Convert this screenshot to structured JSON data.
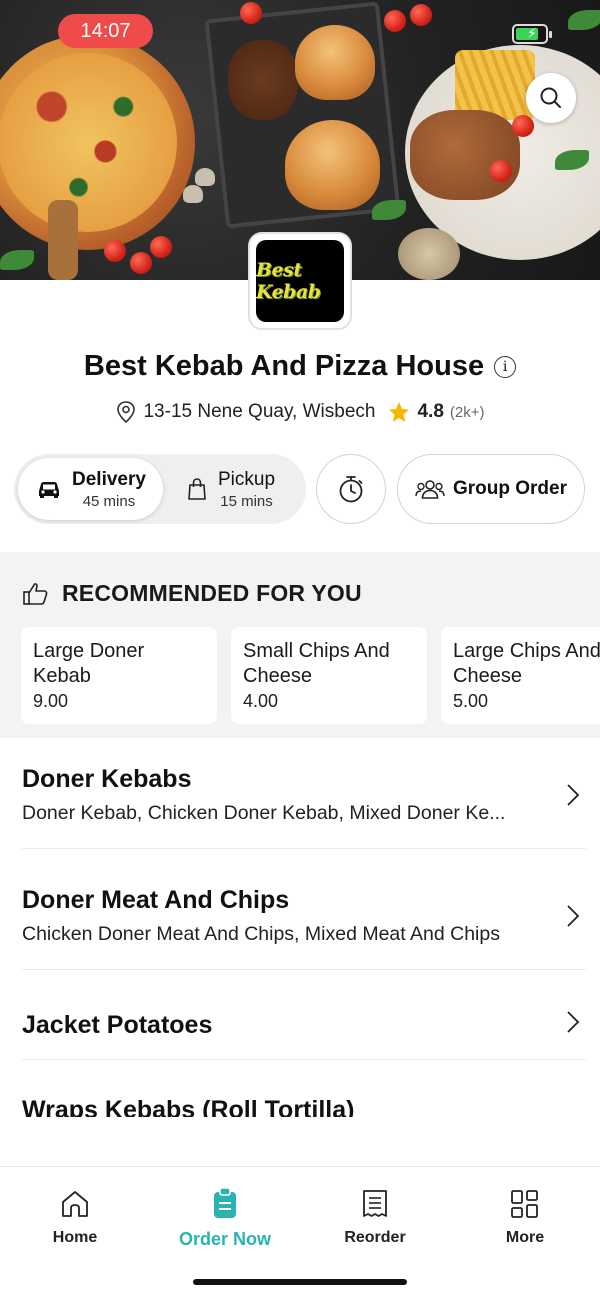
{
  "status": {
    "time": "14:07"
  },
  "icons": {
    "search": "search-icon",
    "info": "info-icon",
    "location": "location-pin-icon",
    "star": "star-icon",
    "car": "car-icon",
    "bag": "shopping-bag-icon",
    "timer": "stopwatch-icon",
    "group": "group-icon",
    "thumbs": "thumbs-up-icon",
    "chevron": "chevron-right-icon"
  },
  "restaurant": {
    "logo_text": "Best Kebab",
    "name": "Best Kebab And Pizza House",
    "address": "13-15 Nene Quay, Wisbech",
    "rating": "4.8",
    "rating_count": "(2k+)"
  },
  "order_type": {
    "delivery_label": "Delivery",
    "delivery_time": "45 mins",
    "pickup_label": "Pickup",
    "pickup_time": "15 mins",
    "group_order_label": "Group Order"
  },
  "recommended": {
    "title": "RECOMMENDED FOR YOU",
    "items": [
      {
        "name": "Large Doner Kebab",
        "price": "9.00"
      },
      {
        "name": "Small Chips And Cheese",
        "price": "4.00"
      },
      {
        "name": "Large Chips And Cheese",
        "price": "5.00"
      }
    ]
  },
  "categories": [
    {
      "name": "Doner Kebabs",
      "items": "Doner Kebab, Chicken Doner Kebab, Mixed Doner Ke..."
    },
    {
      "name": "Doner Meat And Chips",
      "items": "Chicken Doner Meat And Chips, Mixed Meat And Chips"
    },
    {
      "name": "Jacket Potatoes",
      "items": ""
    },
    {
      "name": "Wraps Kebabs (Roll Tortilla)",
      "items": ""
    }
  ],
  "nav": {
    "home": "Home",
    "order_now": "Order Now",
    "reorder": "Reorder",
    "more": "More"
  },
  "colors": {
    "accent": "#2ab3b0",
    "time_pill": "#ef4b4b",
    "star": "#f5b800"
  }
}
